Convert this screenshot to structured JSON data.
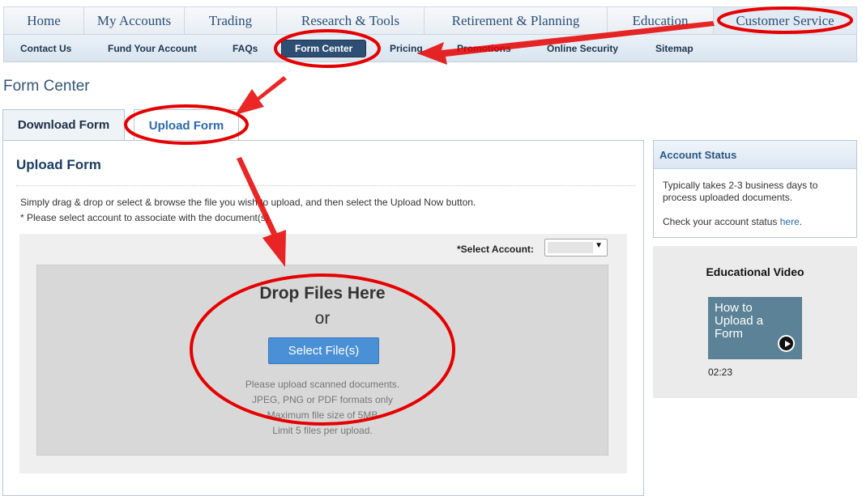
{
  "topnav": {
    "tabs": [
      {
        "label": "Home"
      },
      {
        "label": "My Accounts"
      },
      {
        "label": "Trading"
      },
      {
        "label": "Research & Tools"
      },
      {
        "label": "Retirement & Planning"
      },
      {
        "label": "Education"
      },
      {
        "label": "Customer Service",
        "active": true
      }
    ]
  },
  "subnav": {
    "items": [
      {
        "label": "Contact Us"
      },
      {
        "label": "Fund Your Account"
      },
      {
        "label": "FAQs"
      },
      {
        "label": "Form Center",
        "selected": true
      },
      {
        "label": "Pricing"
      },
      {
        "label": "Promotions"
      },
      {
        "label": "Online Security"
      },
      {
        "label": "Sitemap"
      }
    ]
  },
  "page": {
    "title": "Form Center"
  },
  "tabs": {
    "download": "Download Form",
    "upload": "Upload Form",
    "active": "Upload Form"
  },
  "upload_form": {
    "title": "Upload Form",
    "instruction_1": "Simply drag & drop or select & browse the file you wish to upload, and then select the Upload Now button.",
    "instruction_2": "* Please select account to associate with the document(s).",
    "select_account_label": "*Select Account:",
    "select_account_value": "",
    "drop_title": "Drop Files Here",
    "drop_or": "or",
    "select_files_button": "Select File(s)",
    "notes": [
      "Please upload scanned documents.",
      "JPEG, PNG or PDF formats only",
      "Maximum file size of 5MB",
      "Limit 5 files per upload."
    ]
  },
  "account_status": {
    "title": "Account Status",
    "text": "Typically takes 2-3 business days to process uploaded documents.",
    "check_prefix": "Check your account status",
    "check_link": "here",
    "check_suffix": "."
  },
  "educational_video": {
    "title": "Educational Video",
    "thumbnail_text": "How to Upload a Form",
    "duration": "02:23",
    "icon": "play-icon"
  },
  "annotation_color": "#e60000"
}
